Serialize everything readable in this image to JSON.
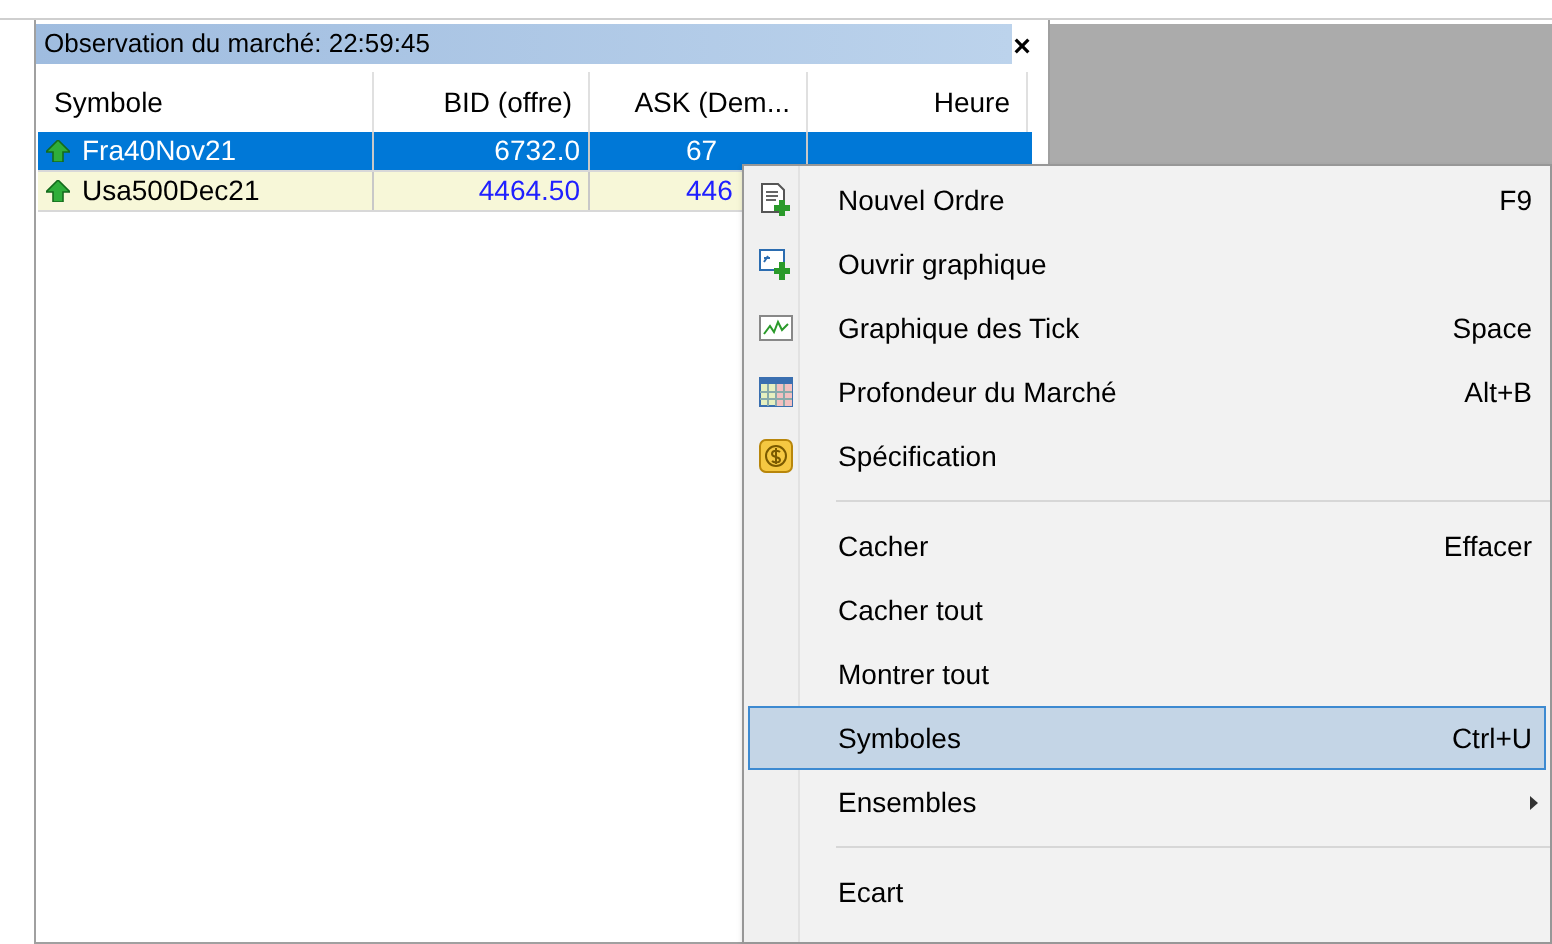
{
  "window": {
    "title": "Observation du marché: 22:59:45",
    "close": "×"
  },
  "table": {
    "columns": [
      {
        "label": "Symbole"
      },
      {
        "label": "BID (offre)"
      },
      {
        "label": "ASK (Dem..."
      },
      {
        "label": "Heure"
      }
    ],
    "rows": [
      {
        "selected": true,
        "cells": [
          "Fra40Nov21",
          "6732.0",
          "67"
        ]
      },
      {
        "selected": false,
        "cells": [
          "Usa500Dec21",
          "4464.50",
          "446"
        ]
      }
    ]
  },
  "context_menu": {
    "items": [
      {
        "kind": "item",
        "label": "Nouvel Ordre",
        "shortcut": "F9",
        "selected": false
      },
      {
        "kind": "item",
        "label": "Ouvrir graphique",
        "selected": false
      },
      {
        "kind": "item",
        "label": "Graphique des Tick",
        "shortcut": "Space",
        "selected": false
      },
      {
        "kind": "item",
        "label": "Profondeur du Marché",
        "shortcut": "Alt+B",
        "selected": false
      },
      {
        "kind": "item",
        "label": "Spécification",
        "selected": false
      },
      {
        "kind": "separator"
      },
      {
        "kind": "item",
        "label": "Cacher",
        "shortcut": "Effacer",
        "selected": false
      },
      {
        "kind": "item",
        "label": "Cacher tout",
        "selected": false
      },
      {
        "kind": "item",
        "label": "Montrer tout",
        "selected": false
      },
      {
        "kind": "item",
        "label": "Symboles",
        "shortcut": "Ctrl+U",
        "selected": true
      },
      {
        "kind": "submenu",
        "label": "Ensembles",
        "selected": false
      },
      {
        "kind": "separator"
      },
      {
        "kind": "item",
        "label": "Ecart",
        "selected": false
      }
    ]
  }
}
